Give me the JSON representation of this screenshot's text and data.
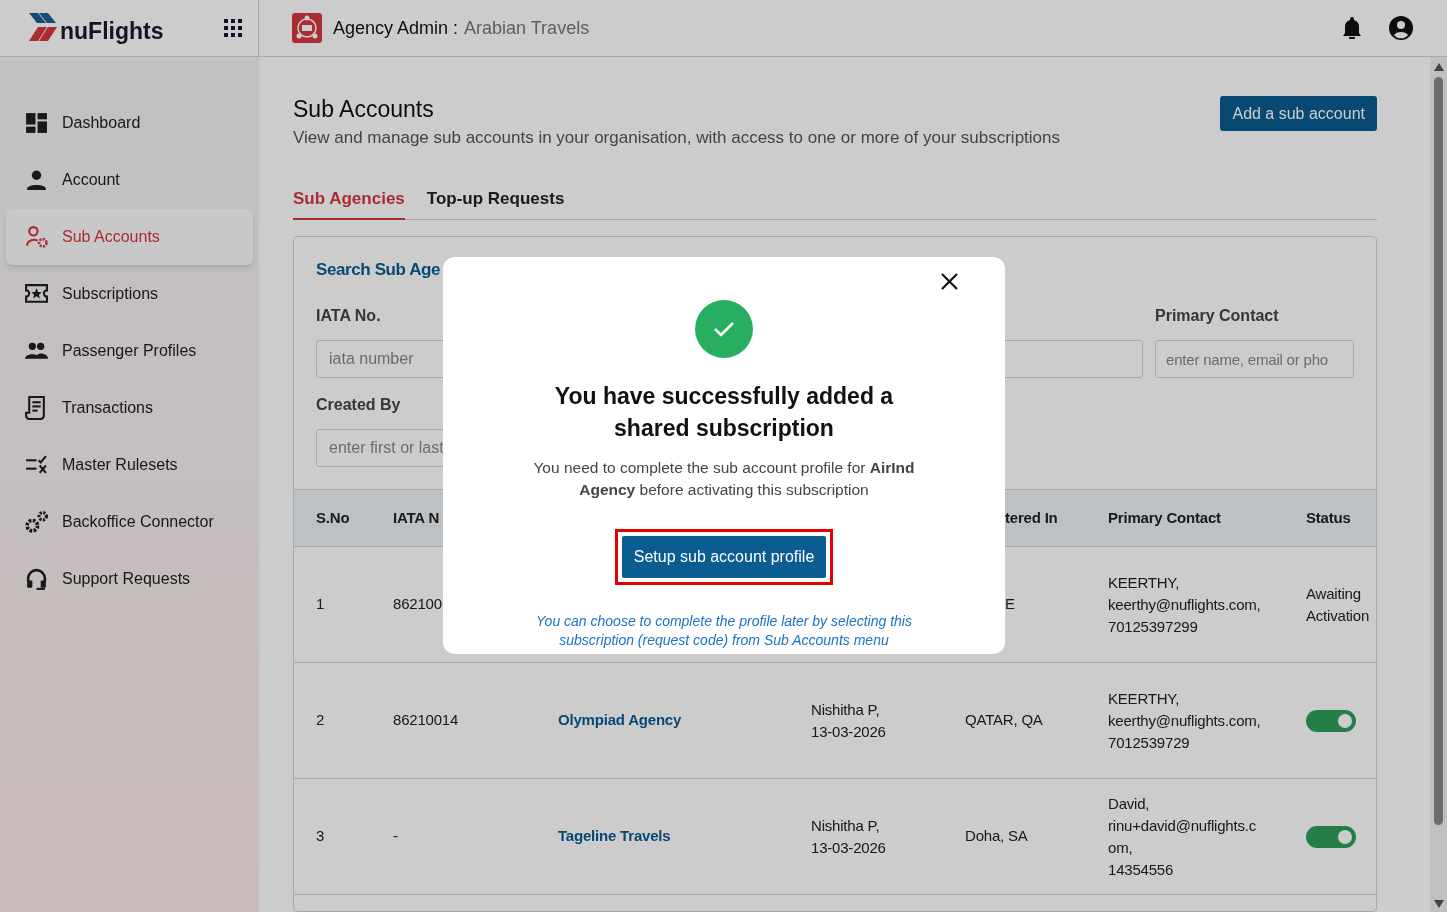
{
  "header": {
    "brand": "nuFlights",
    "title": "Agency Admin :",
    "agency": "Arabian Travels"
  },
  "sidebar": {
    "items": [
      {
        "label": "Dashboard",
        "selected": false
      },
      {
        "label": "Account",
        "selected": false
      },
      {
        "label": "Sub Accounts",
        "selected": true
      },
      {
        "label": "Subscriptions",
        "selected": false
      },
      {
        "label": "Passenger Profiles",
        "selected": false
      },
      {
        "label": "Transactions",
        "selected": false
      },
      {
        "label": "Master Rulesets",
        "selected": false
      },
      {
        "label": "Backoffice Connector",
        "selected": false
      },
      {
        "label": "Support Requests",
        "selected": false
      }
    ]
  },
  "page": {
    "title": "Sub Accounts",
    "subtitle": "View and manage sub accounts in your organisation, with access to one or more of your subscriptions",
    "add_button": "Add a sub account"
  },
  "tabs": [
    {
      "label": "Sub Agencies",
      "selected": true
    },
    {
      "label": "Top-up Requests",
      "selected": false
    }
  ],
  "search": {
    "title": "Search Sub Age",
    "fields": [
      {
        "label": "IATA No.",
        "placeholder": "iata number"
      },
      {
        "label": "Primary Contact",
        "placeholder": "enter name, email or pho"
      },
      {
        "label": "Created By",
        "placeholder": "enter first or last"
      }
    ]
  },
  "table": {
    "columns": [
      "S.No",
      "IATA N",
      "tered In",
      "Primary Contact",
      "Status"
    ],
    "rows": [
      {
        "sno": "1",
        "iata": "862100",
        "agency": "",
        "created": "",
        "registered": "E",
        "contact": "KEERTHY,\nkeerthy@nuflights.com,\n70125397299",
        "status": {
          "kind": "text",
          "text": "Awaiting Activation"
        }
      },
      {
        "sno": "2",
        "iata": "86210014",
        "agency": "Olympiad Agency",
        "created": "Nishitha P, 13-03-2026",
        "registered": "QATAR, QA",
        "contact": "KEERTHY,\nkeerthy@nuflights.com,\n7012539729",
        "status": {
          "kind": "toggle",
          "on": true
        }
      },
      {
        "sno": "3",
        "iata": "-",
        "agency": "Tageline Travels",
        "created": "Nishitha P, 13-03-2026",
        "registered": "Doha, SA",
        "contact": "David,\nrinu+david@nuflights.com,\n14354556",
        "status": {
          "kind": "toggle",
          "on": true
        }
      }
    ]
  },
  "dialog": {
    "title": "You have successfully added a shared subscription",
    "message": "You need to complete the sub account profile for **AirInd Agency** before activating this subscription",
    "button": "Setup sub account profile",
    "button_highlighted": true,
    "note": "You can choose to complete the profile later by selecting this subscription (request code) from Sub Accounts menu"
  }
}
